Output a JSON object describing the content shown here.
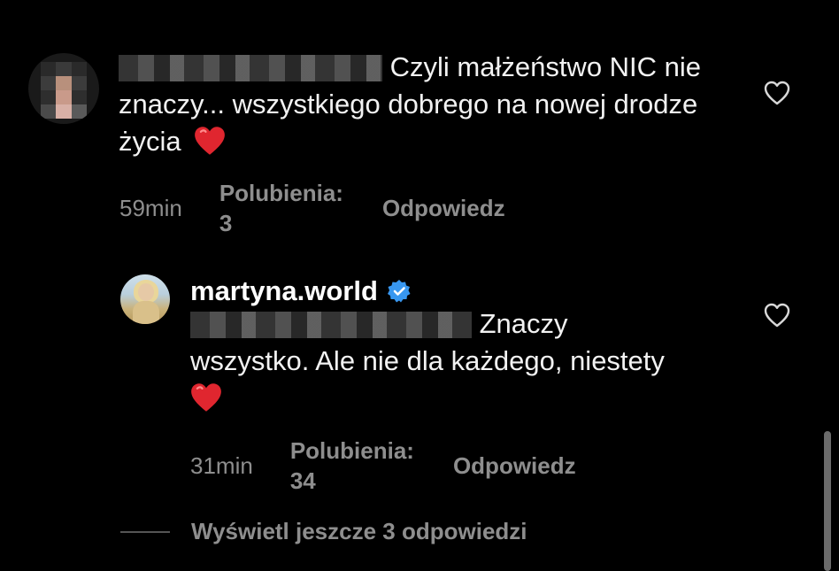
{
  "comments": [
    {
      "text": " Czyli małżeństwo NIC nie znaczy... wszystkiego dobrego na nowej drodze życia",
      "time": "59min",
      "likes_label": "Polubienia: 3",
      "reply_label": "Odpowiedz",
      "heart_emoji": "red-heart"
    },
    {
      "username": "martyna.world",
      "text": "Znaczy wszystko. Ale nie dla każdego, niestety",
      "time": "31min",
      "likes_label": "Polubienia: 34",
      "reply_label": "Odpowiedz",
      "heart_emoji": "red-heart"
    }
  ],
  "view_more_replies": "Wyświetl jeszcze 3 odpowiedzi",
  "icons": {
    "like": "heart-outline-icon",
    "verified": "verified-badge-icon"
  },
  "colors": {
    "background": "#000000",
    "text_primary": "#f2f2f2",
    "text_secondary": "#8e8e8e",
    "verified_blue": "#3897f0",
    "heart_red": "#e0262f"
  }
}
